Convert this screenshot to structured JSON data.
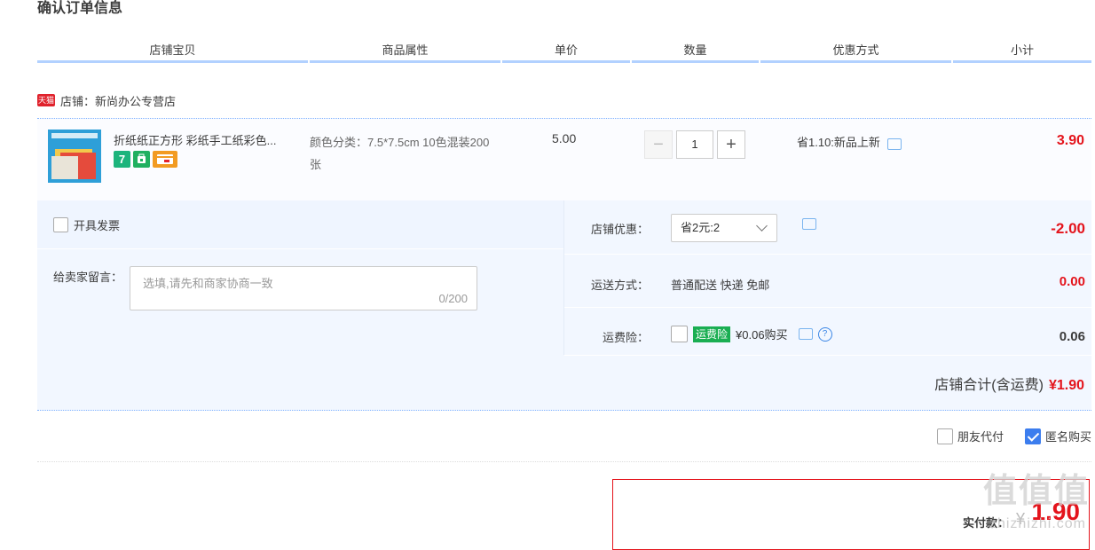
{
  "page": {
    "title": "确认订单信息"
  },
  "columns": [
    "店铺宝贝",
    "商品属性",
    "单价",
    "数量",
    "优惠方式",
    "小计"
  ],
  "shop": {
    "badge": "天猫",
    "name": "店铺：新尚办公专营店"
  },
  "item": {
    "name": "折纸纸正方形 彩纸手工纸彩色...",
    "badge_7": "7",
    "attr": "颜色分类：7.5*7.5cm 10色混装200张",
    "unit_price": "5.00",
    "qty": "1",
    "qty_minus": "−",
    "qty_plus": "+",
    "promo": "省1.10:新品上新",
    "subtotal": "3.90"
  },
  "invoice": {
    "label": "开具发票"
  },
  "message": {
    "label": "给卖家留言：",
    "placeholder": "选填,请先和商家协商一致",
    "count": "0/200"
  },
  "shop_discount": {
    "label": "店铺优惠：",
    "selected": "省2元:2",
    "value": "-2.00"
  },
  "shipping": {
    "label": "运送方式：",
    "method": "普通配送 快递 免邮",
    "value": "0.00"
  },
  "insurance": {
    "label": "运费险：",
    "badge": "运费险",
    "price": "¥0.06购买",
    "help": "?",
    "value": "0.06"
  },
  "shop_total": {
    "label": "店铺合计(含运费)",
    "value": "¥1.90"
  },
  "options": {
    "friend_pay": "朋友代付",
    "anonymous": "匿名购买"
  },
  "payment": {
    "label": "实付款：",
    "yen": "¥",
    "value": "1.90"
  },
  "watermark": {
    "main": "值值值",
    "sub": "zhizhizhi.com"
  },
  "colors": {
    "accent_red": "#e4141c",
    "header_line": "#b2d1ff",
    "panel_bg": "#f2f7ff",
    "check_blue": "#3c7dee"
  }
}
